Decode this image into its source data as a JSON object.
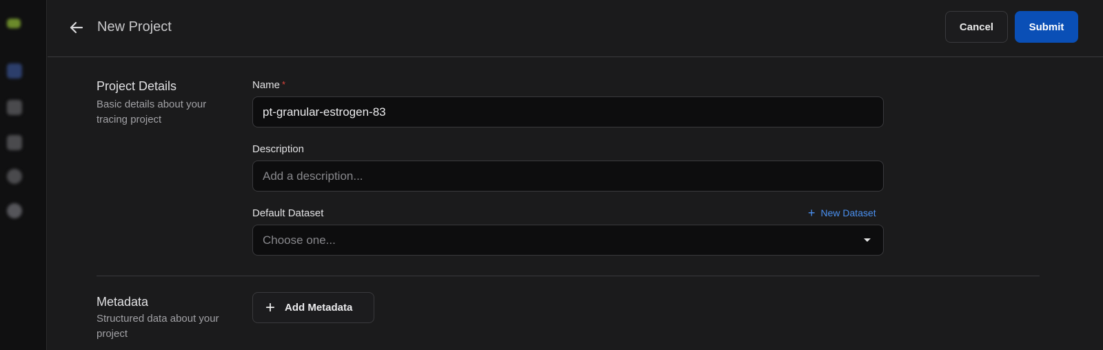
{
  "header": {
    "title": "New Project",
    "cancel_label": "Cancel",
    "submit_label": "Submit"
  },
  "project_details": {
    "title": "Project Details",
    "description": "Basic details about your tracing project"
  },
  "fields": {
    "name": {
      "label": "Name",
      "required_mark": "*",
      "value": "pt-granular-estrogen-83"
    },
    "description": {
      "label": "Description",
      "placeholder": "Add a description..."
    },
    "default_dataset": {
      "label": "Default Dataset",
      "placeholder": "Choose one...",
      "new_dataset_label": "New Dataset"
    }
  },
  "metadata": {
    "title": "Metadata",
    "description": "Structured data about your project",
    "add_label": "Add Metadata"
  },
  "colors": {
    "accent": "#0a4fb6",
    "link": "#4a90f0",
    "required": "#e0443b"
  },
  "icons": {
    "back": "arrow-left-icon",
    "add": "plus-icon",
    "dropdown": "caret-down-icon"
  }
}
